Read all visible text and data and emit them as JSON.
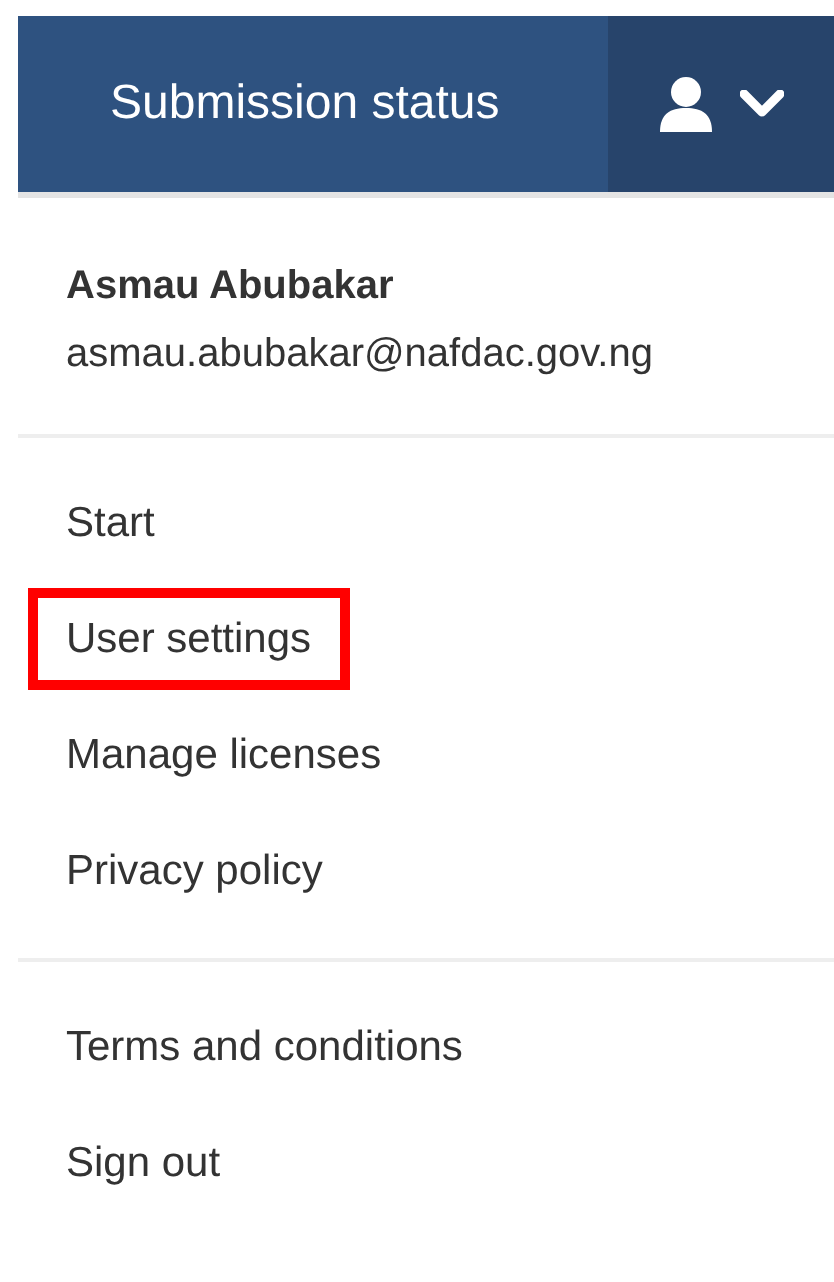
{
  "navbar": {
    "link": "Submission status"
  },
  "user": {
    "name": "Asmau Abubakar",
    "email": "asmau.abubakar@nafdac.gov.ng"
  },
  "menu_groups": [
    [
      {
        "label": "Start",
        "highlighted": false
      },
      {
        "label": "User settings",
        "highlighted": true
      },
      {
        "label": "Manage licenses",
        "highlighted": false
      },
      {
        "label": "Privacy policy",
        "highlighted": false
      }
    ],
    [
      {
        "label": "Terms and conditions",
        "highlighted": false
      },
      {
        "label": "Sign out",
        "highlighted": false
      }
    ]
  ]
}
